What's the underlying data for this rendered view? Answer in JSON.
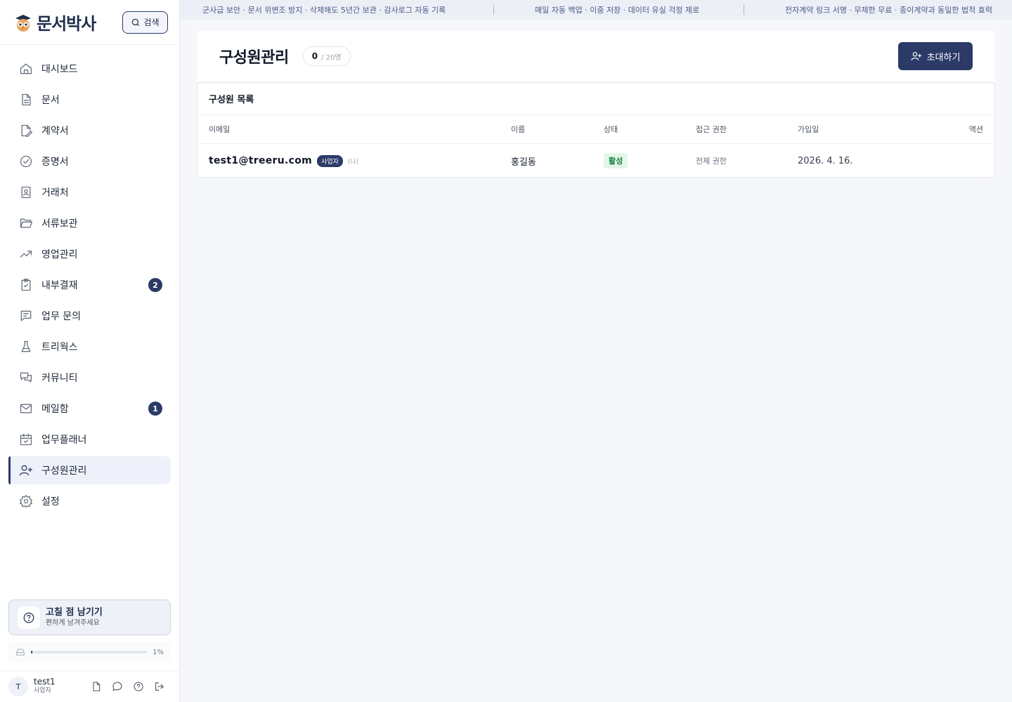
{
  "app": {
    "logo_text": "문서박사",
    "search_label": "검색"
  },
  "banner": {
    "messages": [
      "군사급 보안 · 문서 위변조 방지 · 삭제해도 5년간 보관 · 감사로그 자동 기록",
      "매일 자동 백업 · 이중 저장 · 데이터 유실 걱정 제로",
      "전자계약 링크 서명 · 무제한 무료 · 종이계약과 동일한 법적 효력"
    ]
  },
  "sidebar": {
    "items": [
      {
        "label": "대시보드",
        "icon": "home-icon"
      },
      {
        "label": "문서",
        "icon": "document-icon"
      },
      {
        "label": "계약서",
        "icon": "contract-icon"
      },
      {
        "label": "증명서",
        "icon": "certificate-icon"
      },
      {
        "label": "거래처",
        "icon": "contact-book-icon"
      },
      {
        "label": "서류보관",
        "icon": "folder-icon"
      },
      {
        "label": "영업관리",
        "icon": "trending-up-icon"
      },
      {
        "label": "내부결재",
        "icon": "clipboard-check-icon",
        "badge": "2"
      },
      {
        "label": "업무 문의",
        "icon": "message-square-icon"
      },
      {
        "label": "트리웍스",
        "icon": "flask-icon"
      },
      {
        "label": "커뮤니티",
        "icon": "chat-bubbles-icon"
      },
      {
        "label": "메일함",
        "icon": "mail-icon",
        "badge": "1"
      },
      {
        "label": "업무플래너",
        "icon": "calendar-icon"
      },
      {
        "label": "구성원관리",
        "icon": "user-plus-icon",
        "active": true
      },
      {
        "label": "설정",
        "icon": "gear-icon"
      }
    ],
    "feedback": {
      "title": "고칠 점 남기기",
      "subtitle": "편하게 남겨주세요"
    },
    "storage": {
      "percent_label": "1%",
      "fraction": 0.01
    },
    "user": {
      "initial": "T",
      "name": "test1",
      "role": "사업자"
    }
  },
  "page": {
    "title": "구성원관리",
    "count": "0",
    "capacity": "/ 20명",
    "invite_label": "초대하기"
  },
  "table": {
    "title": "구성원 목록",
    "columns": [
      "이메일",
      "이름",
      "상태",
      "접근 권한",
      "가입일",
      "액션"
    ],
    "rows": [
      {
        "email": "test1@treeru.com",
        "role_tag": "사업자",
        "me_tag": "(나)",
        "name": "홍길동",
        "status": "활성",
        "access": "전체 권한",
        "joined": "2026. 4. 16."
      }
    ]
  },
  "colors": {
    "primary": "#2b3a67",
    "status_active_bg": "#e3f6e8",
    "status_active_text": "#15803d"
  }
}
